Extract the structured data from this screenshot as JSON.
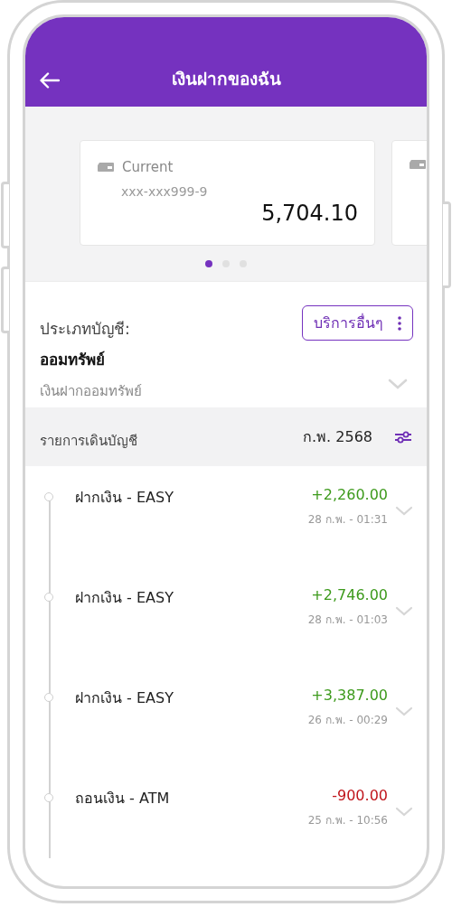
{
  "header": {
    "title": "เงินฝากของฉัน"
  },
  "cards": [
    {
      "kind": "full",
      "label": "Current",
      "account": "xxx-xxx999-9",
      "balance": "5,704.10"
    },
    {
      "kind": "partial"
    }
  ],
  "dots": [
    {
      "selected": true
    },
    {
      "selected": false
    },
    {
      "selected": false
    }
  ],
  "account": {
    "type_label": "ประเภทบัญชี:",
    "type": "ออมทรัพย์",
    "subtype": "เงินฝากออมทรัพย์",
    "services_button": "บริการอื่นๆ",
    "expanded": false
  },
  "statement": {
    "title": "รายการเดินบัญชี",
    "period": "ก.พ. 2568"
  },
  "transactions": [
    {
      "title": "ฝากเงิน - EASY",
      "amount": "+2,260.00",
      "kind": "credit",
      "time": "28 ก.พ. - 01:31"
    },
    {
      "title": "ฝากเงิน - EASY",
      "amount": "+2,746.00",
      "kind": "credit",
      "time": "28 ก.พ. - 01:03"
    },
    {
      "title": "ฝากเงิน - EASY",
      "amount": "+3,387.00",
      "kind": "credit",
      "time": "26 ก.พ. - 00:29"
    },
    {
      "title": "ถอนเงิน - ATM",
      "amount": "-900.00",
      "kind": "debit",
      "time": "25 ก.พ. - 10:56"
    }
  ]
}
